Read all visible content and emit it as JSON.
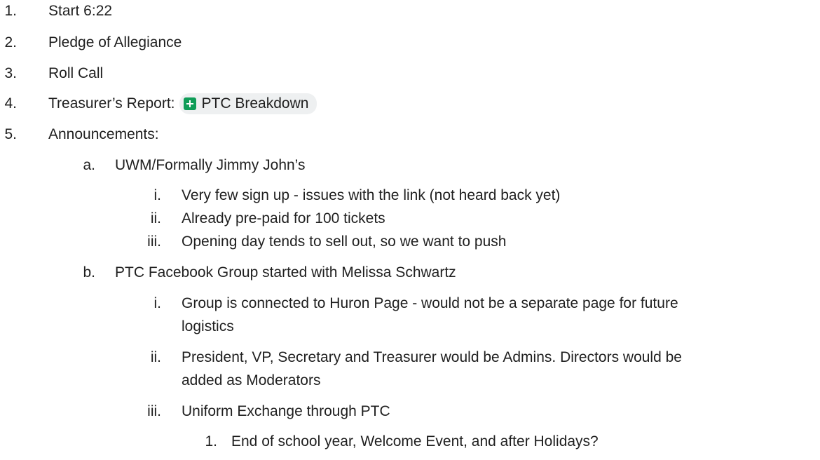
{
  "colors": {
    "text": "#1f1f1f",
    "chip_bg": "#eef0f1",
    "sheets_icon": "#0f9d58"
  },
  "items": [
    {
      "marker": "1.",
      "text": "Start 6:22"
    },
    {
      "marker": "2.",
      "text": "Pledge of Allegiance"
    },
    {
      "marker": "3.",
      "text": "Roll Call"
    },
    {
      "marker": "4.",
      "text": "Treasurer’s Report:",
      "chip": {
        "icon": "google-sheets-icon",
        "label": "PTC Breakdown"
      }
    },
    {
      "marker": "5.",
      "text": "Announcements:"
    },
    {
      "marker": "a.",
      "text": "UWM/Formally Jimmy John’s"
    },
    {
      "marker": "i.",
      "text": "Very few sign up - issues with the link (not heard back yet)"
    },
    {
      "marker": "ii.",
      "text": "Already pre-paid for 100 tickets"
    },
    {
      "marker": "iii.",
      "text": "Opening day tends to sell out, so we want to push"
    },
    {
      "marker": "b.",
      "text": "PTC Facebook Group started with Melissa Schwartz"
    },
    {
      "marker": "i.",
      "text": "Group is connected to Huron Page - would not be a separate page for future"
    },
    {
      "text": "logistics"
    },
    {
      "marker": "ii.",
      "text": "President, VP, Secretary and Treasurer would be Admins. Directors would be"
    },
    {
      "text": "added as Moderators"
    },
    {
      "marker": "iii.",
      "text": "Uniform Exchange through PTC"
    },
    {
      "marker": "1.",
      "text": "End of school year, Welcome Event, and after Holidays?"
    }
  ]
}
